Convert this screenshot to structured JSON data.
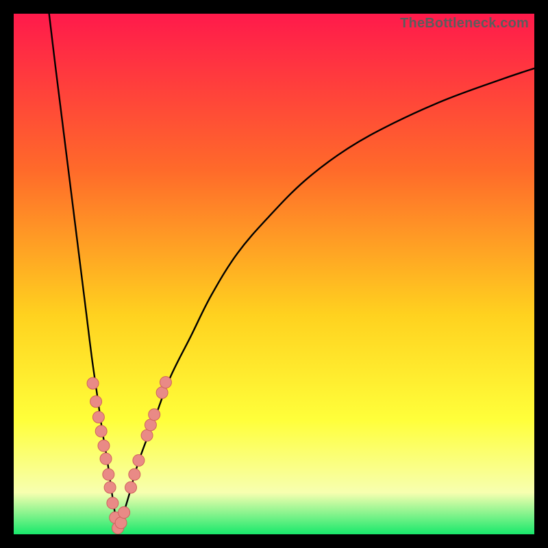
{
  "watermark": "TheBottleneck.com",
  "colors": {
    "gradient_top": "#ff1a4b",
    "gradient_mid1": "#ff6a2a",
    "gradient_mid2": "#ffd21f",
    "gradient_mid3": "#ffff3a",
    "gradient_mid4": "#f7ffb0",
    "gradient_bottom": "#18e86b",
    "curve": "#000000",
    "dot_fill": "#e98a86",
    "dot_stroke": "#cf625d"
  },
  "chart_data": {
    "type": "line",
    "title": "",
    "xlabel": "",
    "ylabel": "",
    "xlim": [
      0,
      100
    ],
    "ylim": [
      0,
      100
    ],
    "x_optimum": 20,
    "series": [
      {
        "name": "left-branch",
        "x": [
          6.8,
          8,
          9,
          10,
          11,
          12,
          13,
          14,
          15,
          16,
          17,
          18,
          19,
          20
        ],
        "y": [
          100,
          90,
          82,
          74,
          66,
          58,
          50,
          42,
          34,
          27,
          20,
          14,
          7,
          0.5
        ]
      },
      {
        "name": "right-branch",
        "x": [
          20,
          22,
          24,
          27,
          30,
          34,
          38,
          43,
          49,
          56,
          64,
          73,
          83,
          94,
          100
        ],
        "y": [
          0.5,
          7,
          14,
          22,
          30,
          38,
          46,
          54,
          61,
          68,
          74,
          79,
          83.5,
          87.5,
          89.5
        ]
      }
    ],
    "points": [
      {
        "x": 15.2,
        "y": 29
      },
      {
        "x": 15.8,
        "y": 25.5
      },
      {
        "x": 16.3,
        "y": 22.5
      },
      {
        "x": 16.8,
        "y": 19.8
      },
      {
        "x": 17.3,
        "y": 17
      },
      {
        "x": 17.7,
        "y": 14.5
      },
      {
        "x": 18.2,
        "y": 11.5
      },
      {
        "x": 18.5,
        "y": 9
      },
      {
        "x": 19.0,
        "y": 6
      },
      {
        "x": 19.5,
        "y": 3.2
      },
      {
        "x": 20.0,
        "y": 1.2
      },
      {
        "x": 20.6,
        "y": 2.2
      },
      {
        "x": 21.2,
        "y": 4.2
      },
      {
        "x": 22.5,
        "y": 9
      },
      {
        "x": 23.2,
        "y": 11.5
      },
      {
        "x": 24.0,
        "y": 14.2
      },
      {
        "x": 25.6,
        "y": 19.0
      },
      {
        "x": 26.3,
        "y": 21.0
      },
      {
        "x": 27.0,
        "y": 23.0
      },
      {
        "x": 28.5,
        "y": 27.2
      },
      {
        "x": 29.2,
        "y": 29.2
      }
    ]
  }
}
